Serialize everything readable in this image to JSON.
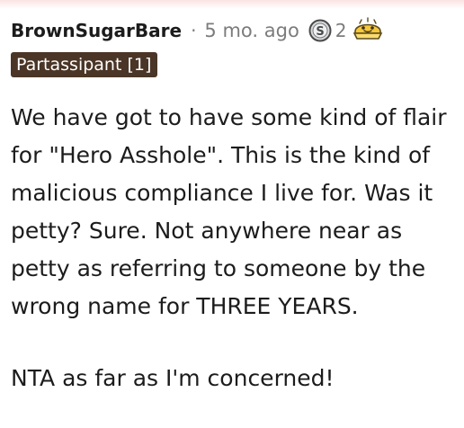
{
  "comment": {
    "author": "BrownSugarBare",
    "separator": "·",
    "timestamp": "5 mo. ago",
    "awards": [
      {
        "icon": "silver-award-icon",
        "count": "2"
      },
      {
        "icon": "wholesome-award-icon",
        "count": ""
      }
    ],
    "flair": "Partassipant [1]",
    "paragraphs": [
      "We have got to have some kind of flair for \"Hero Asshole\". This is the kind of malicious compliance I live for. Was it petty? Sure. Not anywhere near as petty as referring to someone by the wrong name for THREE YEARS.",
      "NTA as far as I'm concerned!"
    ]
  },
  "colors": {
    "text": "#1c1c1c",
    "meta": "#7c7c7c",
    "flair_bg": "#4a3526",
    "flair_text": "#ffffff",
    "award_gold": "#f5c73b",
    "top_fade": "#fbe3e3"
  }
}
